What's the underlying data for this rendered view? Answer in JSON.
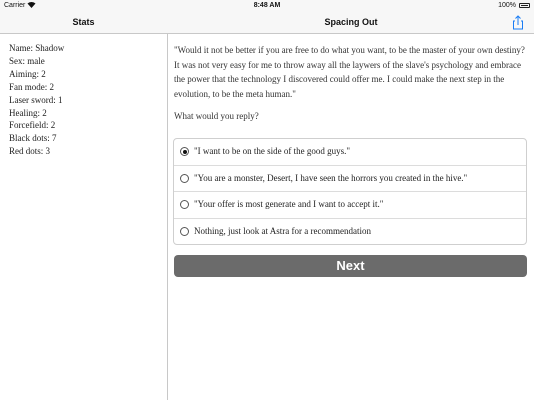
{
  "status_bar": {
    "carrier": "Carrier",
    "wifi_icon": "wifi-icon",
    "time": "8:48 AM",
    "battery_percent": "100%",
    "battery_icon": "battery-icon"
  },
  "sidebar": {
    "title": "Stats",
    "stats": [
      "Name: Shadow",
      "Sex: male",
      "Aiming: 2",
      "Fan mode: 2",
      "Laser sword: 1",
      "Healing: 2",
      "Forcefield: 2",
      "Black dots: 7",
      "Red dots: 3"
    ]
  },
  "main": {
    "title": "Spacing Out",
    "share_icon": "share-icon",
    "accent_color": "#1a7cf4",
    "story": "\"Would it not be better if you are free to do what you want, to be the master of your own destiny? It was not very easy for me to throw away all the laywers of the slave's psychology and embrace the power that the technology I discovered could offer me. I could make the next step in the evolution, to be the meta human.\"",
    "prompt": "What would you reply?",
    "options": [
      {
        "label": "\"I want to be on the side of the good guys.\"",
        "selected": true
      },
      {
        "label": "\"You are a monster, Desert, I have seen the horrors you created in the hive.\"",
        "selected": false
      },
      {
        "label": "\"Your offer is most generate and I want to accept it.\"",
        "selected": false
      },
      {
        "label": "Nothing, just look at Astra for a recommendation",
        "selected": false
      }
    ],
    "next_label": "Next",
    "next_button_color": "#6b6b6b"
  }
}
